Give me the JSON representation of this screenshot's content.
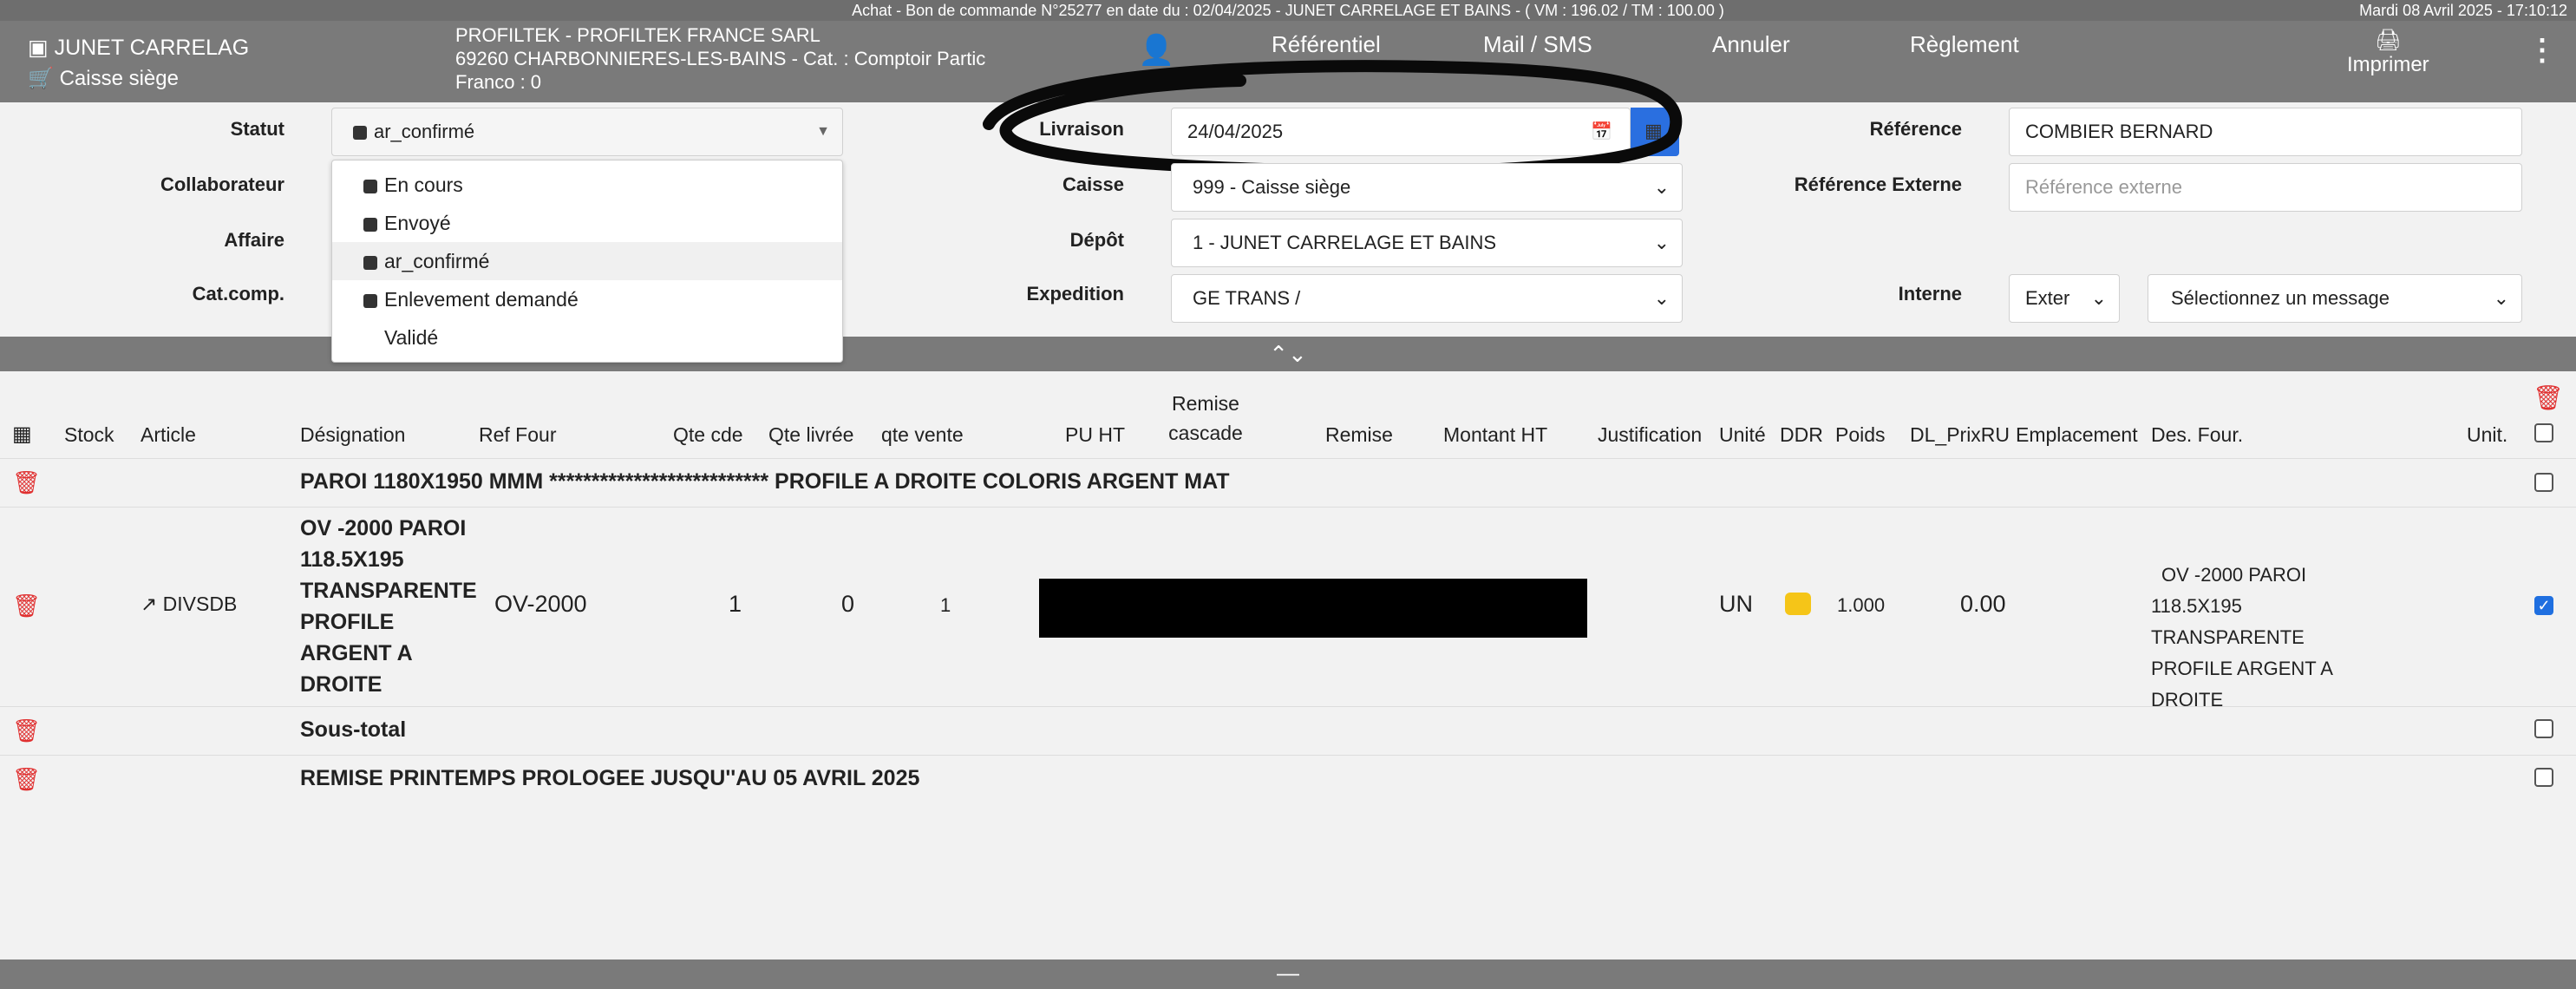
{
  "topbar": {
    "title": "Achat - Bon de commande N°25277 en date du : 02/04/2025 - JUNET CARRELAGE ET BAINS - ( VM : 196.02 / TM : 100.00 )",
    "datetime": "Mardi 08 Avril 2025 - 17:10:12"
  },
  "header": {
    "store": "JUNET CARRELAG",
    "caisse": "Caisse siège",
    "supplier_line1": "PROFILTEK - PROFILTEK FRANCE SARL",
    "supplier_line2": "69260 CHARBONNIERES-LES-BAINS - Cat. : Comptoir Partic",
    "supplier_line3": "Franco : 0",
    "menu": [
      "Référentiel",
      "Mail / SMS",
      "Annuler",
      "Règlement"
    ],
    "print": "Imprimer"
  },
  "form": {
    "statut_label": "Statut",
    "statut_value": "ar_confirmé",
    "collaborateur_label": "Collaborateur",
    "affaire_label": "Affaire",
    "catcomp_label": "Cat.comp.",
    "livraison_label": "Livraison",
    "livraison_value": "24/04/2025",
    "caisse_label": "Caisse",
    "caisse_value": "999 - Caisse siège",
    "depot_label": "Dépôt",
    "depot_value": "1 - JUNET CARRELAGE ET BAINS",
    "expedition_label": "Expedition",
    "expedition_value": "GE TRANS /",
    "reference_label": "Référence",
    "reference_value": "COMBIER BERNARD",
    "refext_label": "Référence Externe",
    "refext_placeholder": "Référence externe",
    "interne_label": "Interne",
    "interne_value": "Exter",
    "message_value": "Sélectionnez un message"
  },
  "status_options": [
    {
      "label": "En cours",
      "has_square": true
    },
    {
      "label": "Envoyé",
      "has_square": true
    },
    {
      "label": "ar_confirmé",
      "has_square": true
    },
    {
      "label": "Enlevement demandé",
      "has_square": true
    },
    {
      "label": "Validé",
      "has_square": false
    }
  ],
  "columns": [
    "Stock",
    "Article",
    "Désignation",
    "Ref Four",
    "Qte cde",
    "Qte livrée",
    "qte vente",
    "PU HT",
    "Remise cascade",
    "Remise",
    "Montant HT",
    "Justification",
    "Unité",
    "DDR",
    "Poids",
    "DL_PrixRU",
    "Emplacement",
    "Des. Four.",
    "Unit."
  ],
  "rows": {
    "r1": {
      "text": "PAROI 1180X1950 MMM ************************** PROFILE A DROITE COLORIS ARGENT MAT"
    },
    "r2": {
      "article": "DIVSDB",
      "designation": "OV -2000 PAROI 118.5X195 TRANSPARENTE PROFILE ARGENT A DROITE",
      "ref_four": "OV-2000",
      "qte_cde": "1",
      "qte_livree": "0",
      "qte_vente": "1",
      "unite": "UN",
      "poids": "1.000",
      "dl_prixru": "0.00",
      "des_four": "OV -2000 PAROI 118.5X195 TRANSPARENTE PROFILE ARGENT A DROITE"
    },
    "r3": {
      "text": "Sous-total"
    },
    "r4": {
      "text": "REMISE PRINTEMPS PROLOGEE JUSQU''AU 05 AVRIL 2025"
    }
  }
}
